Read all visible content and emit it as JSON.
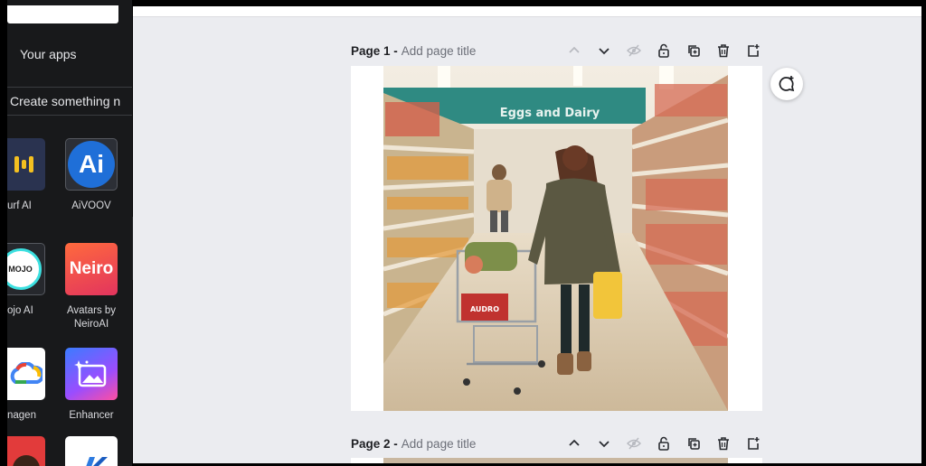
{
  "sidebar": {
    "section_title": "Your apps",
    "create_label": "Create something n",
    "apps": [
      {
        "name": "urf AI",
        "name2": ""
      },
      {
        "name": "AiVOOV",
        "name2": ""
      },
      {
        "name": "ojo AI",
        "name2": ""
      },
      {
        "name": "Avatars by",
        "name2": "NeiroAI"
      },
      {
        "name": "nagen",
        "name2": ""
      },
      {
        "name": "Enhancer",
        "name2": ""
      }
    ],
    "icon_text": {
      "aivoov": "Ai",
      "mojo": "MOJO",
      "neiro": "Neiro"
    }
  },
  "pages": [
    {
      "label": "Page 1 -",
      "title_placeholder": "Add page title"
    },
    {
      "label": "Page 2 -",
      "title_placeholder": "Add page title"
    }
  ],
  "image": {
    "aisle_sign": "Eggs and Dairy",
    "cart_sign": "AUDRO"
  },
  "colors": {
    "sidebar_bg": "#18191b",
    "canvas_bg": "#ebecf0",
    "sign_teal": "#2f8a82"
  }
}
